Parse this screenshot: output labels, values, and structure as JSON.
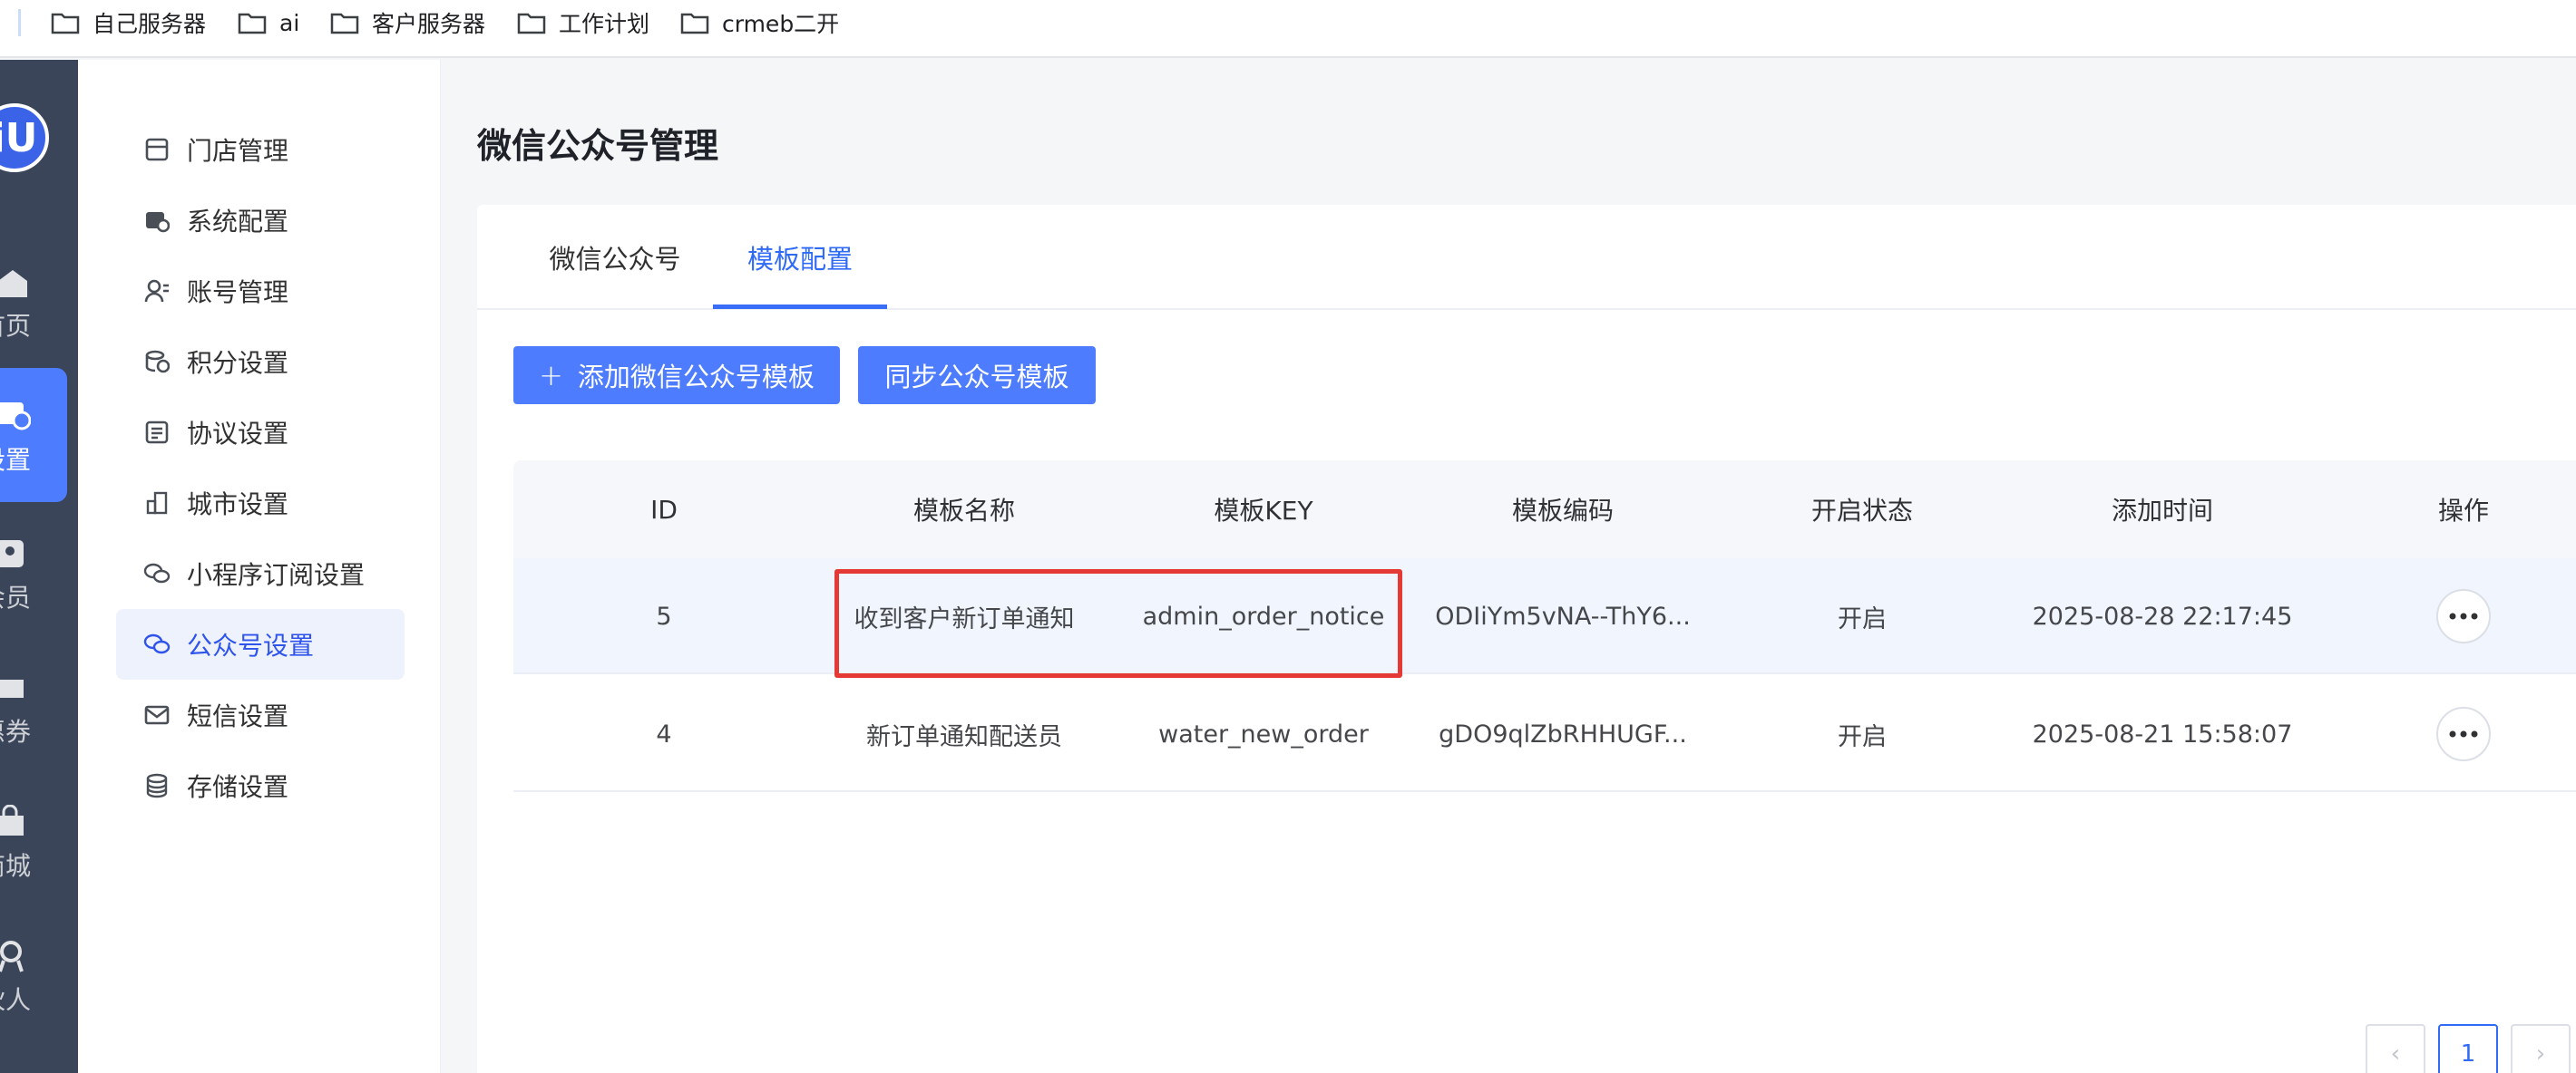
{
  "bookmarks": [
    {
      "label": "自己服务器",
      "icon": "folder-icon"
    },
    {
      "label": "ai",
      "icon": "folder-icon"
    },
    {
      "label": "客户服务器",
      "icon": "folder-icon"
    },
    {
      "label": "工作计划",
      "icon": "folder-icon"
    },
    {
      "label": "crmeb二开",
      "icon": "folder-icon"
    }
  ],
  "rail": {
    "items": [
      {
        "label": "首页",
        "icon": "home-icon"
      },
      {
        "label": "设置",
        "icon": "settings-icon",
        "active": true
      },
      {
        "label": "会员",
        "icon": "member-icon"
      },
      {
        "label": "优惠券",
        "icon": "coupon-icon"
      },
      {
        "label": "积分商城",
        "icon": "shop-icon"
      },
      {
        "label": "合伙人",
        "icon": "partner-icon"
      }
    ]
  },
  "submenu": {
    "items": [
      {
        "label": "门店管理",
        "icon": "store-icon"
      },
      {
        "label": "系统配置",
        "icon": "system-config-icon"
      },
      {
        "label": "账号管理",
        "icon": "account-icon"
      },
      {
        "label": "积分设置",
        "icon": "points-icon"
      },
      {
        "label": "协议设置",
        "icon": "agreement-icon"
      },
      {
        "label": "城市设置",
        "icon": "city-icon"
      },
      {
        "label": "小程序订阅设置",
        "icon": "wechat-icon"
      },
      {
        "label": "公众号设置",
        "icon": "wechat-icon",
        "active": true
      },
      {
        "label": "短信设置",
        "icon": "mail-icon"
      },
      {
        "label": "存储设置",
        "icon": "database-icon"
      }
    ]
  },
  "page": {
    "title": "微信公众号管理",
    "tabs": [
      {
        "label": "微信公众号"
      },
      {
        "label": "模板配置",
        "active": true
      }
    ],
    "add_button": "添加微信公众号模板",
    "sync_button": "同步公众号模板"
  },
  "table": {
    "headers": [
      "ID",
      "模板名称",
      "模板KEY",
      "模板编码",
      "开启状态",
      "添加时间",
      "操作"
    ],
    "rows": [
      {
        "id": "5",
        "name": "收到客户新订单通知",
        "key": "admin_order_notice",
        "code": "ODIiYm5vNA--ThY6...",
        "status": "开启",
        "time": "2025-08-28 22:17:45"
      },
      {
        "id": "4",
        "name": "新订单通知配送员",
        "key": "water_new_order",
        "code": "gDO9qlZbRHHUGF...",
        "status": "开启",
        "time": "2025-08-21 15:58:07"
      }
    ]
  },
  "pagination": {
    "current": "1",
    "prev": "‹",
    "next": "›"
  },
  "colors": {
    "accent": "#4d7cfe",
    "rail": "#3b4559",
    "highlight": "#e53935"
  }
}
